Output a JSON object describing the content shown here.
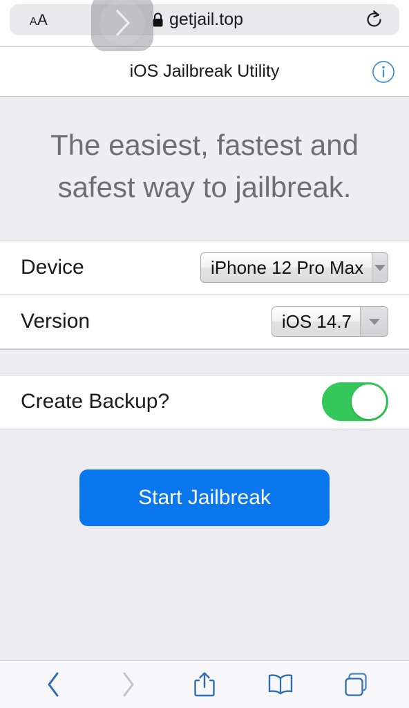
{
  "browser": {
    "text_size_small": "A",
    "text_size_large": "A",
    "url": "getjail.top",
    "secure": true,
    "toolbar": {
      "back_label": "Back",
      "forward_label": "Forward",
      "share_label": "Share",
      "bookmarks_label": "Bookmarks",
      "tabs_label": "Tabs"
    }
  },
  "overlay": {
    "type": "chevron-right",
    "visible": true
  },
  "page": {
    "header": {
      "title": "iOS Jailbreak Utility",
      "info_label": "i"
    },
    "hero": {
      "line1": "The easiest, fastest and",
      "line2": "safest way to jailbreak."
    },
    "form": {
      "device": {
        "label": "Device",
        "value": "iPhone 12 Pro Max"
      },
      "version": {
        "label": "Version",
        "value": "iOS 14.7"
      },
      "backup": {
        "label": "Create Backup?",
        "state": "on"
      }
    },
    "cta": {
      "label": "Start Jailbreak"
    }
  },
  "colors": {
    "accent_blue": "#0B77EE",
    "toggle_green": "#34C759",
    "page_bg": "#EDEDF2",
    "toolbar_blue": "#3478C6"
  }
}
